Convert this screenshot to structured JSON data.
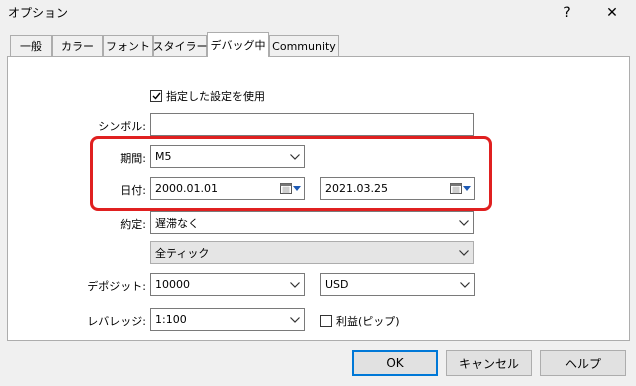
{
  "window": {
    "title": "オプション",
    "help_symbol": "?",
    "close_symbol": "✕"
  },
  "tabs": [
    {
      "label": "一般",
      "active": false
    },
    {
      "label": "カラー",
      "active": false
    },
    {
      "label": "フォント",
      "active": false
    },
    {
      "label": "スタイラー",
      "active": false
    },
    {
      "label": "デバッグ中",
      "active": true
    },
    {
      "label": "Community",
      "active": false
    }
  ],
  "form": {
    "use_specified": {
      "label": "指定した設定を使用",
      "checked": true
    },
    "symbol": {
      "label": "シンボル:",
      "value": ""
    },
    "period": {
      "label": "期間:",
      "value": "M5"
    },
    "date": {
      "label": "日付:",
      "from": "2000.01.01",
      "to": "2021.03.25"
    },
    "execution": {
      "label": "約定:",
      "value": "遅滞なく"
    },
    "model": {
      "value": "全ティック"
    },
    "deposit": {
      "label": "デポジット:",
      "value": "10000",
      "currency": "USD"
    },
    "leverage": {
      "label": "レバレッジ:",
      "value": "1:100"
    },
    "profit_pips": {
      "label": "利益(ピップ)",
      "checked": false
    }
  },
  "buttons": {
    "ok": "OK",
    "cancel": "キャンセル",
    "help": "ヘルプ"
  },
  "colors": {
    "highlight": "#e02020",
    "accent": "#0078d7"
  }
}
